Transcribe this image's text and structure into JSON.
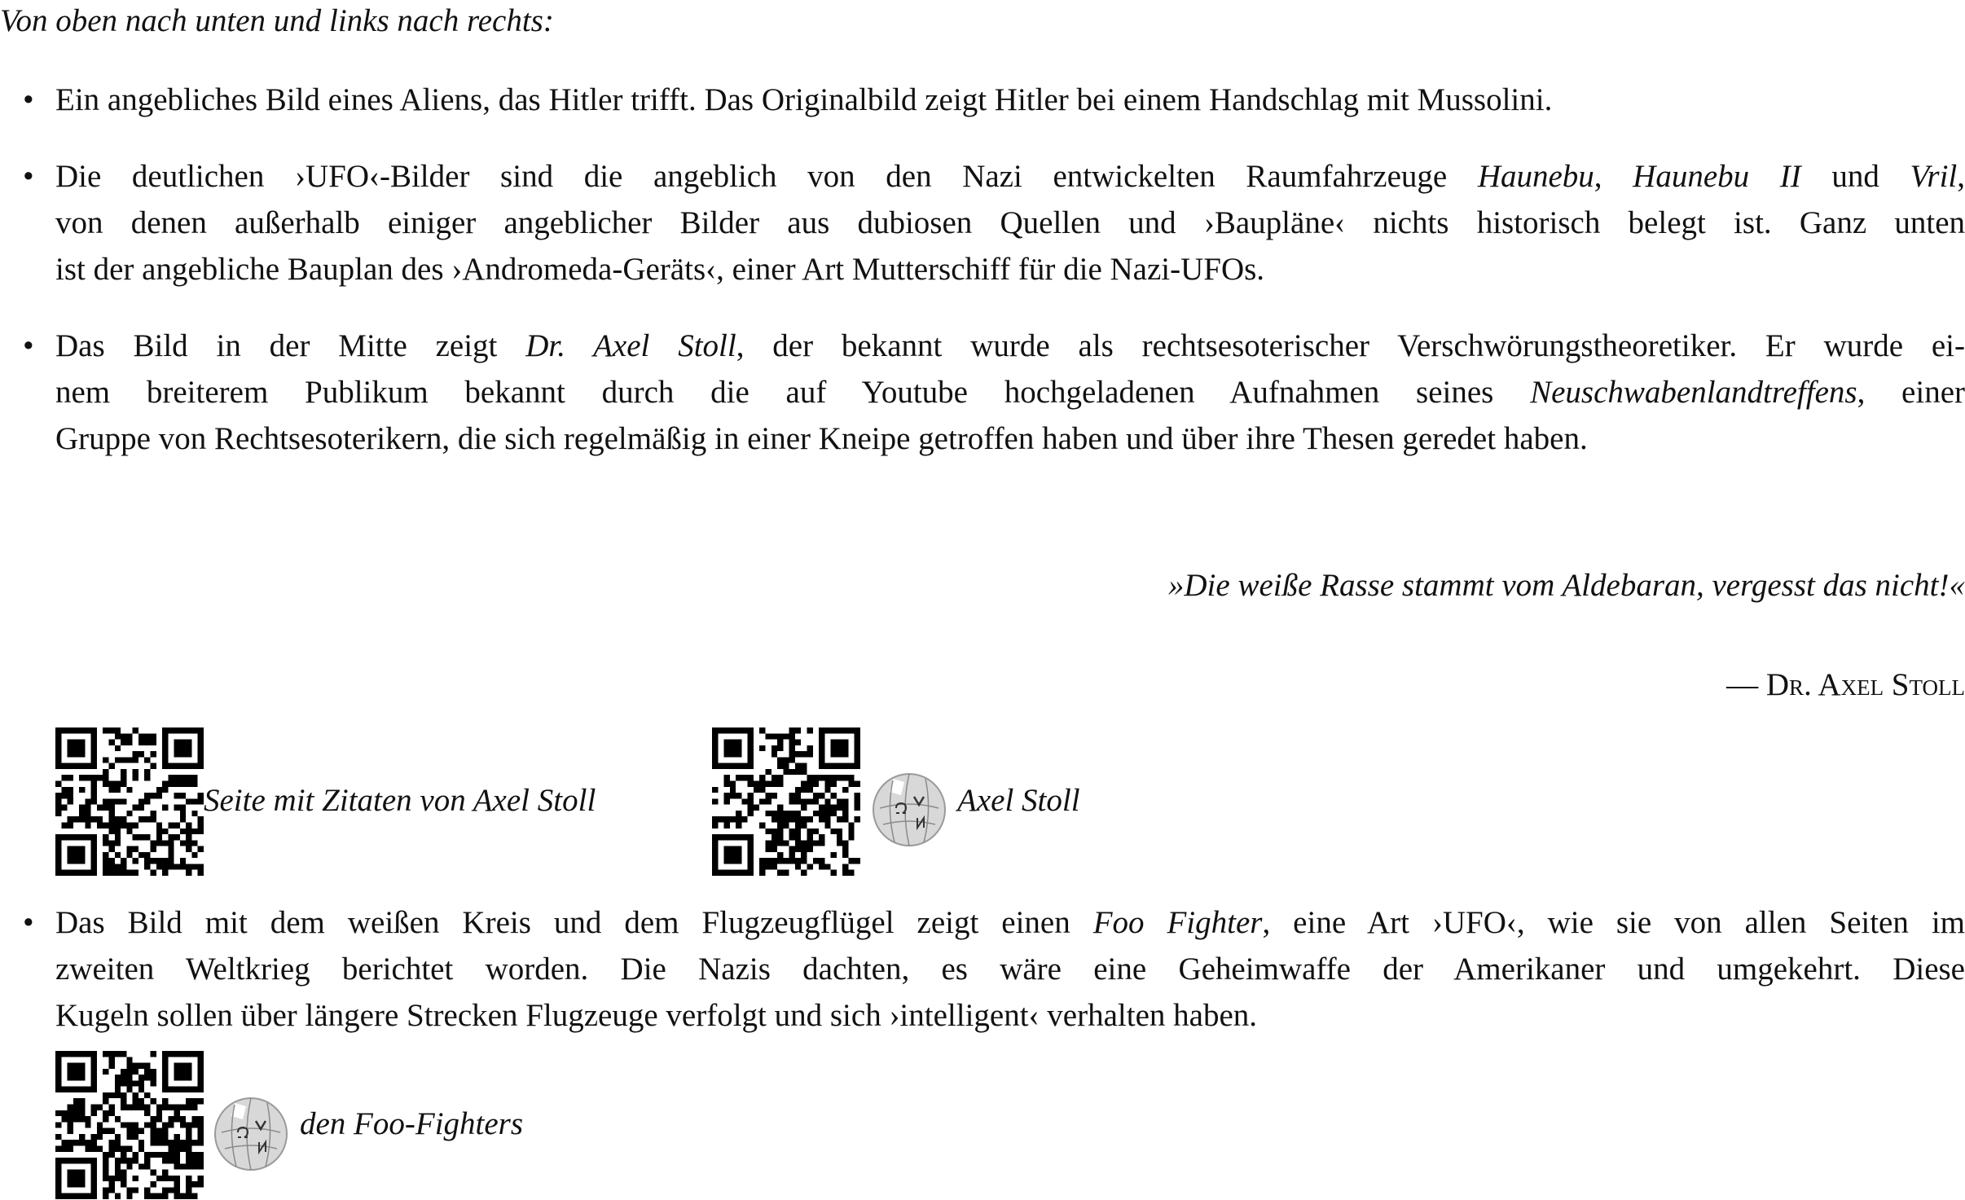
{
  "intro": "Von oben nach unten und links nach rechts:",
  "bullet1": {
    "marker": "•",
    "l1": "Ein angebliches Bild eines Aliens, das Hitler trifft. Das Originalbild zeigt Hitler bei einem Handschlag mit Mussolini."
  },
  "bullet2": {
    "marker": "•",
    "l1_a": "Die deutlichen ›UFO‹-Bilder sind die angeblich von den Nazi entwickelten Raumfahrzeuge ",
    "l1_b": "Haunebu",
    "l1_c": ", ",
    "l1_d": "Haunebu II",
    "l1_e": " und ",
    "l1_f": "Vril",
    "l1_g": ",",
    "l2": "von denen außerhalb einiger angeblicher Bilder aus dubiosen Quellen und ›Baupläne‹ nichts historisch belegt ist. Ganz unten",
    "l3": "ist der angebliche Bauplan des ›Andromeda-Geräts‹, einer Art Mutterschiff für die Nazi-UFOs."
  },
  "bullet3": {
    "marker": "•",
    "l1_a": "Das Bild in der Mitte zeigt ",
    "l1_b": "Dr. Axel Stoll",
    "l1_c": ", der bekannt wurde als rechtsesoterischer Verschwörungstheoretiker. Er wurde ei-",
    "l2_a": "nem breiterem Publikum bekannt durch die auf Youtube hochgeladenen Aufnahmen seines ",
    "l2_b": "Neuschwabenlandtreffens",
    "l2_c": ", einer",
    "l3": "Gruppe von Rechtsesoterikern, die sich regelmäßig in einer Kneipe getroffen haben und über ihre Thesen geredet haben."
  },
  "quote": "»Die weiße Rasse stammt vom Aldebaran, vergesst das nicht!«",
  "author": "— Dr. Axel Stoll",
  "links": {
    "zitate_label": "Seite mit Zitaten von Axel Stoll",
    "stoll_wiki_label": "Axel Stoll",
    "foo_wiki_label": "den Foo-Fighters"
  },
  "bullet4": {
    "marker": "•",
    "l1_a": "Das Bild mit dem weißen Kreis und dem Flugzeugflügel zeigt einen ",
    "l1_b": "Foo Fighter",
    "l1_c": ", eine Art ›UFO‹, wie sie von allen Seiten im",
    "l2": "zweiten Weltkrieg berichtet worden. Die Nazis dachten, es wäre eine Geheimwaffe der Amerikaner und umgekehrt. Diese",
    "l3": "Kugeln sollen über längere Strecken Flugzeuge verfolgt und sich ›intelligent‹ verhalten haben."
  },
  "icons": {
    "qr": "qr-code-icon",
    "wikipedia": "wikipedia-globe-icon"
  }
}
